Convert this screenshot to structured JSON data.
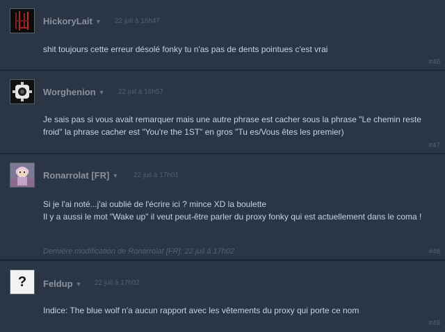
{
  "comments": [
    {
      "author": "HickoryLait",
      "time": "22 juil à 16h47",
      "text": "shit toujours cette erreur désolé fonky tu n'as pas de dents pointues c'est vrai",
      "number": "#46"
    },
    {
      "author": "Worghenion",
      "time": "22 juil à 16h57",
      "text": "Je sais pas si vous avait remarquer mais une autre phrase est cacher sous la phrase \"Le chemin reste froid\" la phrase cacher est \"You're the 1ST\" en gros \"Tu es/Vous êtes les premier)",
      "number": "#47"
    },
    {
      "author": "Ronarrolat [FR]",
      "time": "22 juil à 17h01",
      "text_line1": "Si je l'ai noté...j'ai oublié de l'écrire ici ? mince XD la boulette",
      "text_line2": "Il y a aussi le mot \"Wake up\" il veut peut-être parler du proxy fonky qui est actuellement dans le coma !",
      "edited": "Dernière modification de Ronarrolat [FR]; 22 juil à 17h02",
      "number": "#48"
    },
    {
      "author": "Feldup",
      "time": "22 juil à 17h02",
      "text": "Indice: The blue wolf n'a aucun rapport avec les vêtements du proxy qui porte ce nom",
      "number": "#49",
      "avatar_glyph": "?"
    }
  ]
}
